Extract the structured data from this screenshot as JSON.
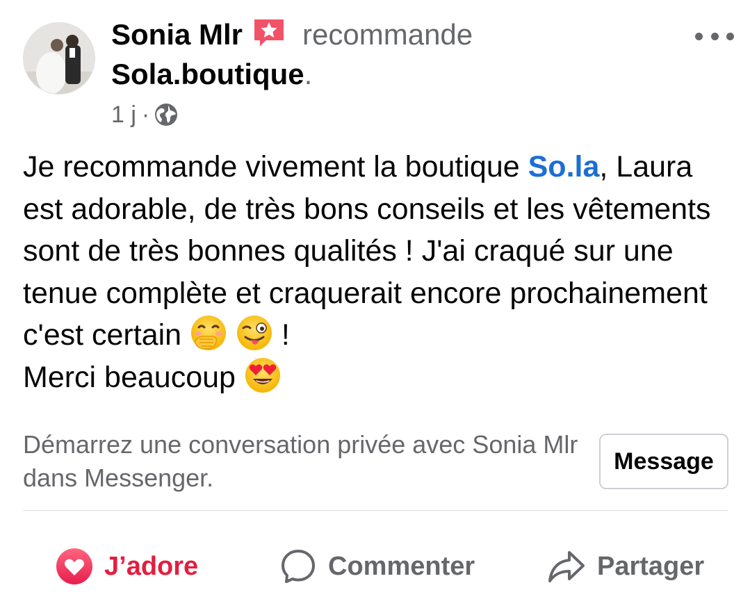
{
  "post": {
    "author": "Sonia Mlr",
    "action": "recommande",
    "page": "Sola.boutique",
    "page_suffix": ".",
    "time": "1 j",
    "separator": "·",
    "body": {
      "text1": "Je recommande vivement la boutique ",
      "link": "So.la",
      "text2": ", Laura est adorable, de très bons conseils et les vêtements sont de très bonnes qualités ! J'ai craqué sur une tenue complète et craquerait encore prochainement c'est certain ",
      "text3": " !",
      "text4": "Merci beaucoup "
    }
  },
  "messenger": {
    "prompt": "Démarrez une conversation privée avec Sonia Mlr dans Messenger.",
    "button_label": "Message"
  },
  "actions": {
    "love_label": "J’adore",
    "comment_label": "Commenter",
    "share_label": "Partager"
  },
  "colors": {
    "link": "#1a6fd4",
    "love": "#e41e3f",
    "secondary_text": "#65676b",
    "badge": "#f25268"
  },
  "icons": {
    "badge": "recommendation-star-badge-icon",
    "privacy": "globe-icon",
    "more": "more-options-icon",
    "emoji_1": "hand-over-mouth-emoji",
    "emoji_2": "winking-tongue-emoji",
    "emoji_3": "heart-eyes-emoji",
    "love": "heart-icon",
    "comment": "comment-bubble-icon",
    "share": "share-arrow-icon"
  }
}
